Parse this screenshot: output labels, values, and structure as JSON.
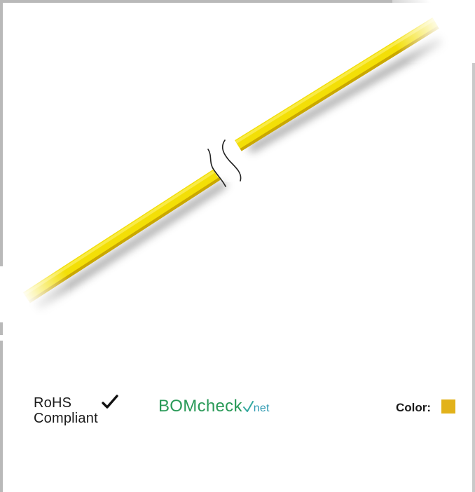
{
  "product": {
    "image_alt": "",
    "wire_color": "#f2dc07",
    "wire_dark": "#d9b800",
    "break_mark_color": "#222222"
  },
  "rohs": {
    "line1": "RoHS",
    "line2": "Compliant",
    "icon": "checkmark-icon"
  },
  "bomcheck": {
    "part1": "BOMcheck",
    "part2": "net",
    "icon": "check-mark-icon",
    "colors": {
      "bom": "#2a9a58",
      "check": "#35a9a0",
      "net": "#2f9ab2"
    }
  },
  "color": {
    "label": "Color:",
    "swatch": "#e2b21a"
  }
}
